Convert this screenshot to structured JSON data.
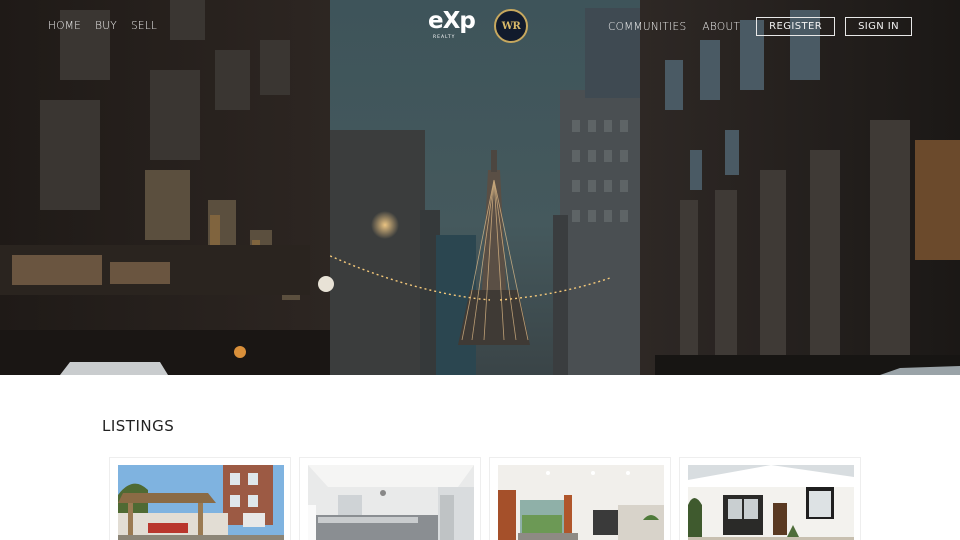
{
  "nav": {
    "left_links": [
      "HOME",
      "BUY",
      "SELL"
    ],
    "right_links": [
      "COMMUNITIES",
      "ABOUT"
    ],
    "register_label": "REGISTER",
    "signin_label": "SIGN IN"
  },
  "logos": {
    "exp_text": "eXp",
    "exp_sub": "REALTY",
    "badge_text": "WR"
  },
  "listings": {
    "title": "LISTINGS"
  },
  "colors": {
    "hero_sky": "#3d5257",
    "badge_gold": "#c7a85e",
    "badge_navy": "#111a2c"
  }
}
